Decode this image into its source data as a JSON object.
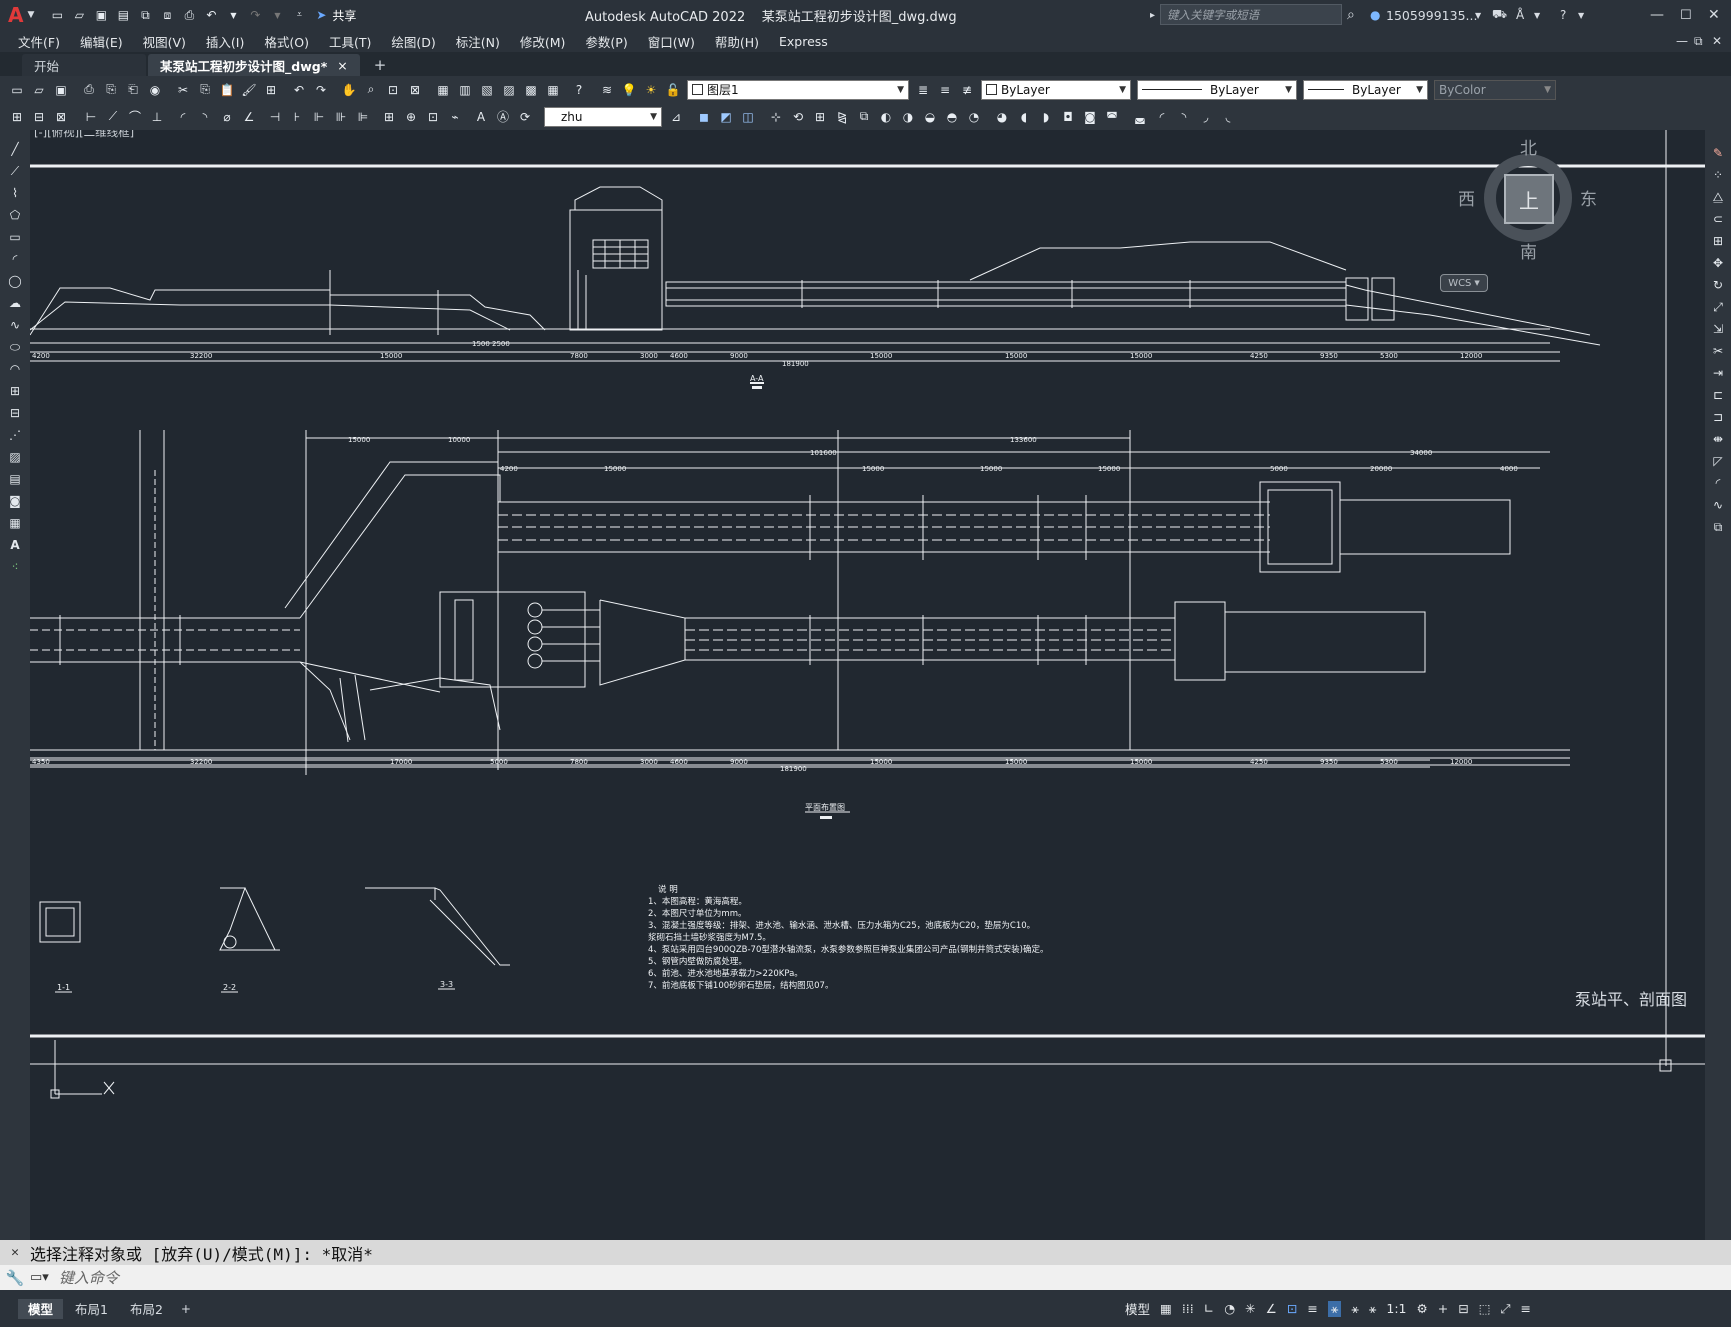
{
  "app": {
    "name": "Autodesk AutoCAD 2022",
    "document": "某泵站工程初步设计图_dwg.dwg",
    "share": "共享",
    "search_placeholder": "键入关键字或短语",
    "user": "1505999135..."
  },
  "menus": [
    "文件(F)",
    "编辑(E)",
    "视图(V)",
    "插入(I)",
    "格式(O)",
    "工具(T)",
    "绘图(D)",
    "标注(N)",
    "修改(M)",
    "参数(P)",
    "窗口(W)",
    "帮助(H)",
    "Express"
  ],
  "tabs": {
    "start": "开始",
    "active": "某泵站工程初步设计图_dwg*",
    "close": "×",
    "add": "+"
  },
  "toolbar": {
    "layer": "图层1",
    "color": "ByLayer",
    "linetype": "ByLayer",
    "lineweight": "ByLayer",
    "plotstyle": "ByColor",
    "text_style": "zhu"
  },
  "viewport": {
    "label": "[-][俯视][二维线框]",
    "compass": {
      "north": "北",
      "south": "南",
      "east": "东",
      "west": "西",
      "top": "上",
      "wcs": "WCS"
    }
  },
  "drawing": {
    "section_aa": "A-A",
    "plan_title": "平面布置图",
    "notes_title": "说  明",
    "notes": [
      "1、本图高程：黄海高程。",
      "2、本图尺寸单位为mm。",
      "3、混凝土强度等级：排架、进水池、输水涵、泄水槽、压力水箱为C25，池底板为C20，垫层为C10。",
      "   浆砌石挡土墙砂浆强度为M7.5。",
      "4、泵站采用四台900QZB-70型潜水轴流泵，水泵参数参照巨神泵业集团公司产品(钢制井筒式安装)确定。",
      "5、钢管内壁做防腐处理。",
      "6、前池、进水池地基承载力>220KPa。",
      "7、前池底板下铺100砂卵石垫层，结构图见07。"
    ],
    "sheet_title": "泵站平、剖面图",
    "section_labels": [
      "1-1",
      "2-2",
      "3-3"
    ],
    "dims_top": [
      "4200",
      "32200",
      "15000",
      "1500",
      "2500",
      "7800",
      "3000",
      "4600",
      "9000",
      "15000",
      "15000",
      "15000",
      "4250",
      "9350",
      "5300",
      "12000"
    ],
    "dims_plan": [
      "4350",
      "32200",
      "17000",
      "5000",
      "7800",
      "3000",
      "4600",
      "9000",
      "15000",
      "15000",
      "15000",
      "4250",
      "9350",
      "5300",
      "12000"
    ],
    "total_top": "181900",
    "total_plan": "181900",
    "plan_top_dims": [
      "15000",
      "10000",
      "4200",
      "15000",
      "15000",
      "15000",
      "15000",
      "5000",
      "20000",
      "4000"
    ],
    "plan_overall_1": "101600",
    "plan_overall_2": "133600",
    "plan_overall_3": "34000"
  },
  "command": {
    "history": "选择注释对象或 [放弃(U)/模式(M)]: *取消*",
    "placeholder": "键入命令"
  },
  "layouts": [
    "模型",
    "布局1",
    "布局2"
  ],
  "status": {
    "model": "模型",
    "scale": "1:1"
  }
}
